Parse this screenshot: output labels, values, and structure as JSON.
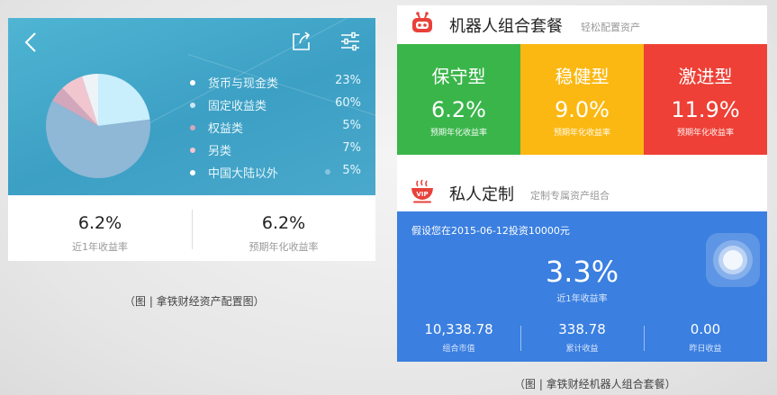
{
  "left_screen": {
    "nav": {
      "back_icon": "chevron-left-icon",
      "share_icon": "share-icon",
      "settings_icon": "sliders-icon"
    },
    "allocation": [
      {
        "label": "货币与现金类",
        "value": "23%",
        "pct": 23,
        "color": "#c9eefc"
      },
      {
        "label": "固定收益类",
        "value": "60%",
        "pct": 60,
        "color": "#8fb7d6"
      },
      {
        "label": "权益类",
        "value": "5%",
        "pct": 5,
        "color": "#d3a7bb"
      },
      {
        "label": "另类",
        "value": "7%",
        "pct": 7,
        "color": "#f2c6cf"
      },
      {
        "label": "中国大陆以外",
        "value": "5%",
        "pct": 5,
        "color": "#eef3f7"
      }
    ],
    "stats": [
      {
        "value": "6.2%",
        "label": "近1年收益率"
      },
      {
        "value": "6.2%",
        "label": "预期年化收益率"
      }
    ]
  },
  "left_caption": "（图 | 拿铁财经资产配置图）",
  "right_screen": {
    "robot_section": {
      "title": "机器人组合套餐",
      "subtitle": "轻松配置资产",
      "icon": "robot-icon"
    },
    "tiles": [
      {
        "name": "保守型",
        "rate": "6.2%",
        "desc": "预期年化收益率",
        "color": "#3ab54a"
      },
      {
        "name": "稳健型",
        "rate": "9.0%",
        "desc": "预期年化收益率",
        "color": "#fbb812"
      },
      {
        "name": "激进型",
        "rate": "11.9%",
        "desc": "预期年化收益率",
        "color": "#ee4036"
      }
    ],
    "vip_section": {
      "title": "私人定制",
      "subtitle": "定制专属资产组合",
      "icon": "vip-cup-icon"
    },
    "vip_panel": {
      "note": "假设您在2015-06-12投资10000元",
      "rate": "3.3%",
      "rate_label": "近1年收益率",
      "stats": [
        {
          "value": "10,338.78",
          "label": "组合市值"
        },
        {
          "value": "338.78",
          "label": "累计收益"
        },
        {
          "value": "0.00",
          "label": "昨日收益"
        }
      ],
      "assistive_icon": "assistive-touch-icon"
    }
  },
  "right_caption": "（图 | 拿铁财经机器人组合套餐）",
  "colors": {
    "left_bg": "#3c9fc4",
    "vip_bg": "#3b7fe0",
    "robot_red": "#e8413a"
  }
}
